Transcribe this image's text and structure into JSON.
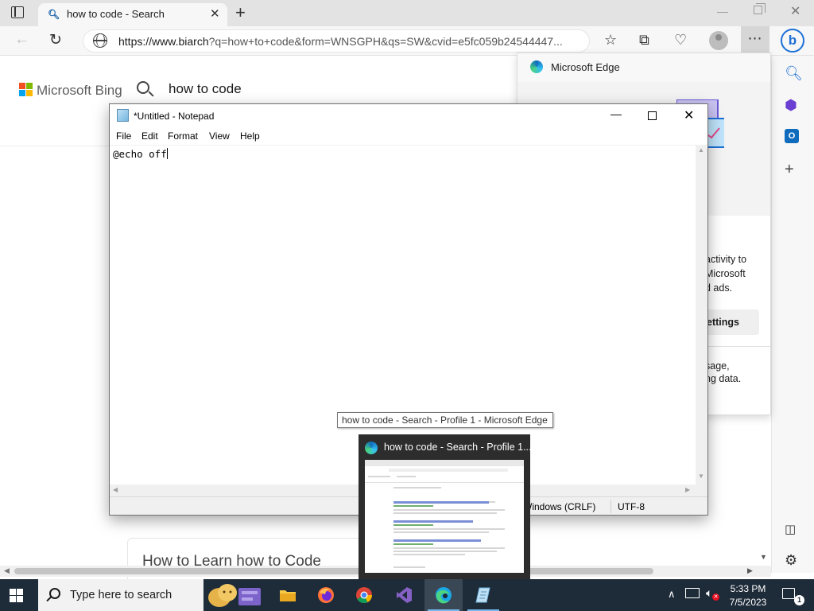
{
  "browser": {
    "tab_title": "how to code - Search",
    "url_main": "https://www.biarch",
    "url_rest": "?q=how+to+code&form=WNSGPH&qs=SW&cvid=e5fc059b24544447...",
    "accent": "#1d6fd6"
  },
  "bing": {
    "brand": "Microsoft Bing",
    "query": "how to code",
    "result_title": "How to Learn how to Code"
  },
  "flyout": {
    "title": "Microsoft Edge",
    "text1": "activity to",
    "text2": "Microsoft",
    "text3": "d ads.",
    "settings_label": "ettings",
    "text4": "sage,",
    "text5": "ng data."
  },
  "notepad": {
    "title": "*Untitled - Notepad",
    "menus": [
      "File",
      "Edit",
      "Format",
      "View",
      "Help"
    ],
    "content": "@echo off",
    "status": {
      "line_ending": "Windows (CRLF)",
      "encoding": "UTF-8"
    }
  },
  "taskbar": {
    "tooltip": "how to code - Search - Profile 1 - Microsoft Edge",
    "preview_title": "how to code - Search - Profile 1...",
    "search_placeholder": "Type here to search",
    "time": "5:33 PM",
    "date": "7/5/2023",
    "notification_count": "1",
    "apps": [
      "file-explorer",
      "firefox",
      "chrome",
      "visual-studio",
      "edge",
      "notepad"
    ]
  }
}
